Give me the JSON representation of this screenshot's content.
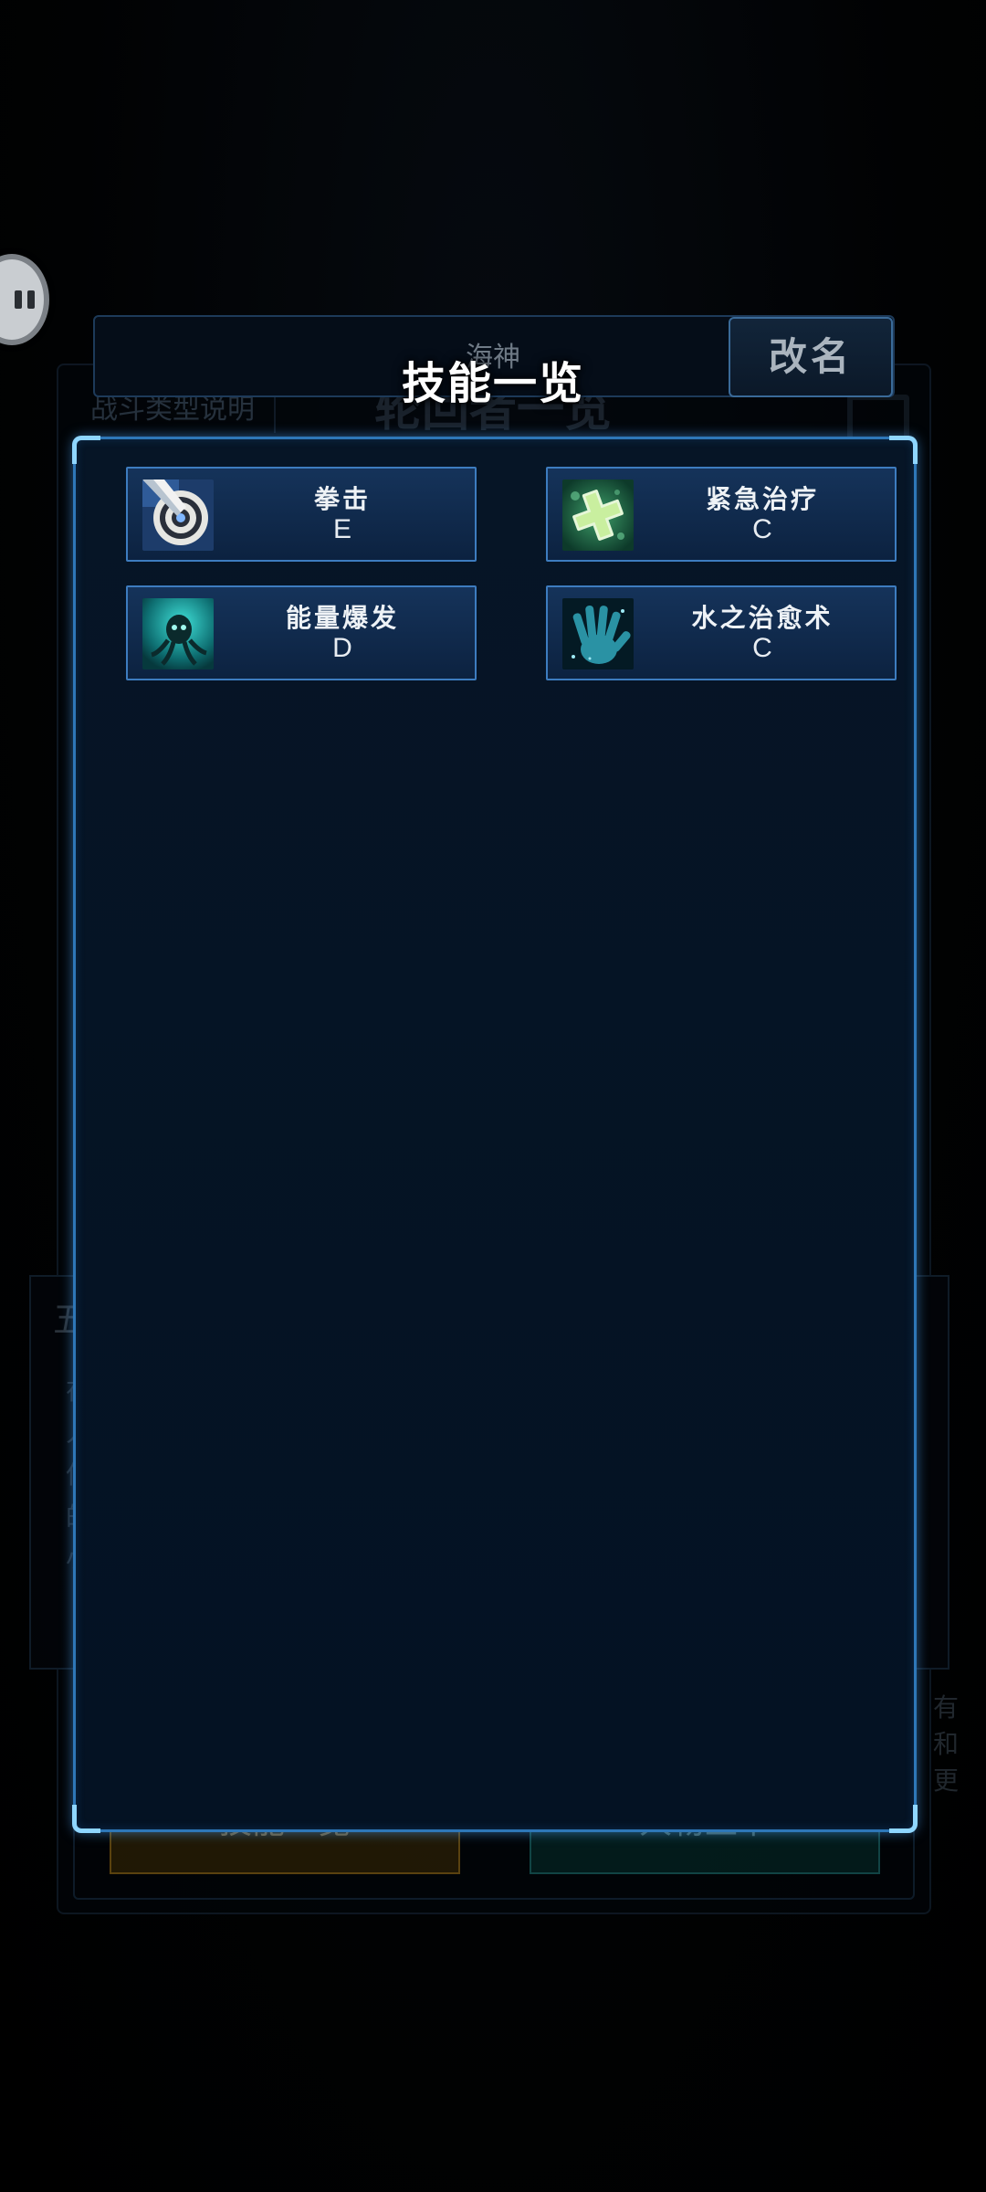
{
  "background": {
    "tab_label": "战斗类型说明",
    "title": "轮回者一览",
    "side_title": "五",
    "side_lines": [
      "在",
      "人",
      "但",
      "的",
      "小"
    ],
    "right_lines": [
      "有",
      "和",
      "更"
    ],
    "bottom_left_button": "技能一览",
    "bottom_right_button": "人物上下"
  },
  "header": {
    "character_name": "海神",
    "dialog_title": "技能一览",
    "rename_button": "改名"
  },
  "skills": [
    {
      "name": "拳击",
      "grade": "E",
      "icon": "target-icon"
    },
    {
      "name": "紧急治疗",
      "grade": "C",
      "icon": "heal-cross-icon"
    },
    {
      "name": "能量爆发",
      "grade": "D",
      "icon": "octopus-icon"
    },
    {
      "name": "水之治愈术",
      "grade": "C",
      "icon": "water-hand-icon"
    }
  ],
  "colors": {
    "panel_border": "#2e77b8",
    "card_bg": "#15335a",
    "card_border": "#3d7cbf",
    "title_text": "#ffffff"
  }
}
